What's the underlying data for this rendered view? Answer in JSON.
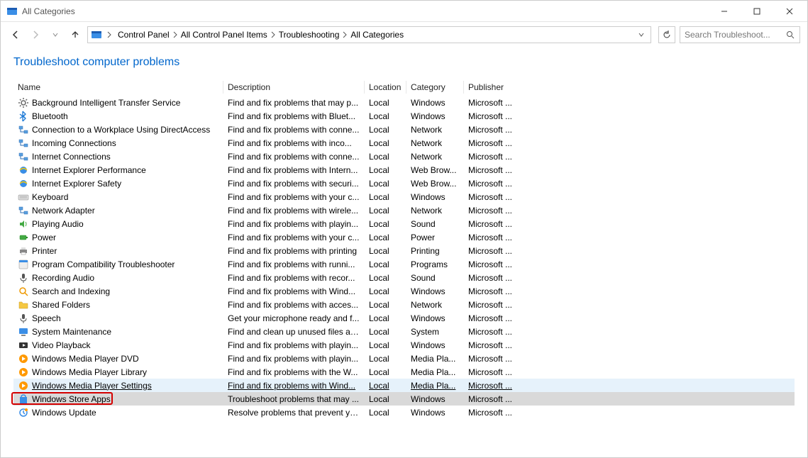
{
  "window": {
    "title": "All Categories"
  },
  "breadcrumb": {
    "items": [
      "Control Panel",
      "All Control Panel Items",
      "Troubleshooting",
      "All Categories"
    ]
  },
  "search": {
    "placeholder": "Search Troubleshoot..."
  },
  "page": {
    "title": "Troubleshoot computer problems"
  },
  "columns": {
    "name": "Name",
    "description": "Description",
    "location": "Location",
    "category": "Category",
    "publisher": "Publisher"
  },
  "rows": [
    {
      "name": "Background Intelligent Transfer Service",
      "desc": "Find and fix problems that may p...",
      "loc": "Local",
      "cat": "Windows",
      "pub": "Microsoft ...",
      "icon": "gear",
      "state": ""
    },
    {
      "name": "Bluetooth",
      "desc": "Find and fix problems with Bluet...",
      "loc": "Local",
      "cat": "Windows",
      "pub": "Microsoft ...",
      "icon": "bluetooth",
      "state": ""
    },
    {
      "name": "Connection to a Workplace Using DirectAccess",
      "desc": "Find and fix problems with conne...",
      "loc": "Local",
      "cat": "Network",
      "pub": "Microsoft ...",
      "icon": "network",
      "state": ""
    },
    {
      "name": "Incoming Connections",
      "desc": "Find and fix problems with inco...",
      "loc": "Local",
      "cat": "Network",
      "pub": "Microsoft ...",
      "icon": "network",
      "state": ""
    },
    {
      "name": "Internet Connections",
      "desc": "Find and fix problems with conne...",
      "loc": "Local",
      "cat": "Network",
      "pub": "Microsoft ...",
      "icon": "network",
      "state": ""
    },
    {
      "name": "Internet Explorer Performance",
      "desc": "Find and fix problems with Intern...",
      "loc": "Local",
      "cat": "Web Brow...",
      "pub": "Microsoft ...",
      "icon": "ie",
      "state": ""
    },
    {
      "name": "Internet Explorer Safety",
      "desc": "Find and fix problems with securi...",
      "loc": "Local",
      "cat": "Web Brow...",
      "pub": "Microsoft ...",
      "icon": "ie",
      "state": ""
    },
    {
      "name": "Keyboard",
      "desc": "Find and fix problems with your c...",
      "loc": "Local",
      "cat": "Windows",
      "pub": "Microsoft ...",
      "icon": "keyboard",
      "state": ""
    },
    {
      "name": "Network Adapter",
      "desc": "Find and fix problems with wirele...",
      "loc": "Local",
      "cat": "Network",
      "pub": "Microsoft ...",
      "icon": "network",
      "state": ""
    },
    {
      "name": "Playing Audio",
      "desc": "Find and fix problems with playin...",
      "loc": "Local",
      "cat": "Sound",
      "pub": "Microsoft ...",
      "icon": "audio",
      "state": ""
    },
    {
      "name": "Power",
      "desc": "Find and fix problems with your c...",
      "loc": "Local",
      "cat": "Power",
      "pub": "Microsoft ...",
      "icon": "power",
      "state": ""
    },
    {
      "name": "Printer",
      "desc": "Find and fix problems with printing",
      "loc": "Local",
      "cat": "Printing",
      "pub": "Microsoft ...",
      "icon": "printer",
      "state": ""
    },
    {
      "name": "Program Compatibility Troubleshooter",
      "desc": "Find and fix problems with runni...",
      "loc": "Local",
      "cat": "Programs",
      "pub": "Microsoft ...",
      "icon": "program",
      "state": ""
    },
    {
      "name": "Recording Audio",
      "desc": "Find and fix problems with recor...",
      "loc": "Local",
      "cat": "Sound",
      "pub": "Microsoft ...",
      "icon": "mic",
      "state": ""
    },
    {
      "name": "Search and Indexing",
      "desc": "Find and fix problems with Wind...",
      "loc": "Local",
      "cat": "Windows",
      "pub": "Microsoft ...",
      "icon": "search",
      "state": ""
    },
    {
      "name": "Shared Folders",
      "desc": "Find and fix problems with acces...",
      "loc": "Local",
      "cat": "Network",
      "pub": "Microsoft ...",
      "icon": "folder",
      "state": ""
    },
    {
      "name": "Speech",
      "desc": "Get your microphone ready and f...",
      "loc": "Local",
      "cat": "Windows",
      "pub": "Microsoft ...",
      "icon": "mic",
      "state": ""
    },
    {
      "name": "System Maintenance",
      "desc": "Find and clean up unused files an...",
      "loc": "Local",
      "cat": "System",
      "pub": "Microsoft ...",
      "icon": "system",
      "state": ""
    },
    {
      "name": "Video Playback",
      "desc": "Find and fix problems with playin...",
      "loc": "Local",
      "cat": "Windows",
      "pub": "Microsoft ...",
      "icon": "video",
      "state": ""
    },
    {
      "name": "Windows Media Player DVD",
      "desc": "Find and fix problems with playin...",
      "loc": "Local",
      "cat": "Media Pla...",
      "pub": "Microsoft ...",
      "icon": "wmp",
      "state": ""
    },
    {
      "name": "Windows Media Player Library",
      "desc": "Find and fix problems with the W...",
      "loc": "Local",
      "cat": "Media Pla...",
      "pub": "Microsoft ...",
      "icon": "wmp",
      "state": ""
    },
    {
      "name": "Windows Media Player Settings",
      "desc": "Find and fix problems with Wind...",
      "loc": "Local",
      "cat": "Media Pla...",
      "pub": "Microsoft ...",
      "icon": "wmp",
      "state": "hover"
    },
    {
      "name": "Windows Store Apps",
      "desc": "Troubleshoot problems that may ...",
      "loc": "Local",
      "cat": "Windows",
      "pub": "Microsoft ...",
      "icon": "store",
      "state": "selected"
    },
    {
      "name": "Windows Update",
      "desc": "Resolve problems that prevent yo...",
      "loc": "Local",
      "cat": "Windows",
      "pub": "Microsoft ...",
      "icon": "update",
      "state": ""
    }
  ],
  "annotation": {
    "target_row_name": "Windows Store Apps"
  }
}
